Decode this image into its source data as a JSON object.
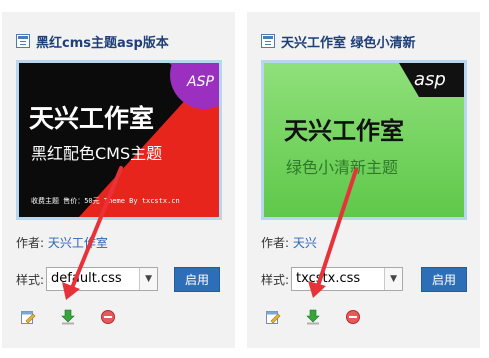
{
  "cards": [
    {
      "title": "黑红cms主题asp版本",
      "thumbnail": {
        "badge": "ASP",
        "brand": "天兴工作室",
        "subtitle": "黑红配色CMS主题",
        "footer": "收费主题 售价：50元 Theme By txcstx.cn"
      },
      "author_label": "作者:",
      "author_name": "天兴工作室",
      "style_label": "样式:",
      "style_value": "default.css",
      "enable_label": "启用"
    },
    {
      "title": "天兴工作室 绿色小清新",
      "thumbnail": {
        "badge": "asp",
        "brand": "天兴工作室",
        "subtitle": "绿色小清新主题"
      },
      "author_label": "作者:",
      "author_name": "天兴",
      "style_label": "样式:",
      "style_value": "txcstx.css",
      "enable_label": "启用"
    }
  ],
  "icons": [
    "edit-icon",
    "download-icon",
    "delete-icon"
  ],
  "colors": {
    "card_bg": "#f2f2f2",
    "title": "#1f3f78",
    "link": "#2a66b4",
    "button": "#2d6eb6",
    "annotation_arrow": "#e8323a"
  }
}
